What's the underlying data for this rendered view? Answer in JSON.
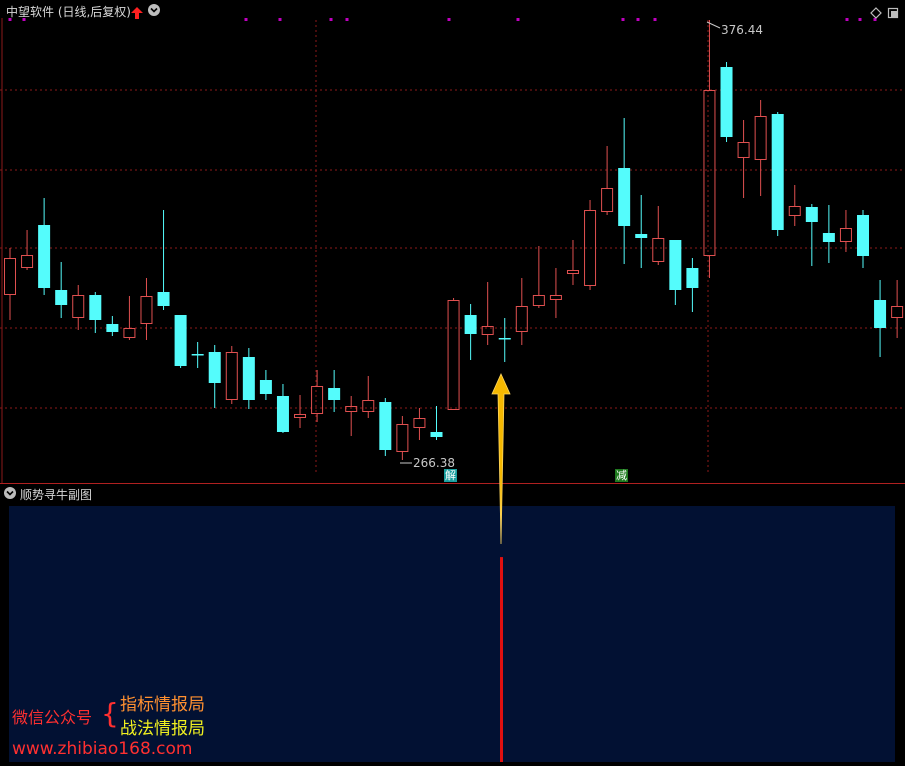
{
  "header": {
    "title": "中望软件 (日线,后复权)",
    "up_arrow": "arrow-up-icon",
    "collapse_icon": "chevron-down-icon",
    "right_icons": [
      "diamond-icon",
      "restore-icon"
    ]
  },
  "price_labels": {
    "high": "376.44",
    "low": "266.38"
  },
  "signals": {
    "jie": "解",
    "jian": "减"
  },
  "subchart": {
    "title": "顺势寻牛副图"
  },
  "watermark": {
    "account_label": "微信公众号",
    "line1": "指标情报局",
    "line2": "战法情报局",
    "url": "www.zhibiao168.com"
  },
  "colors": {
    "background": "#000000",
    "up": "#e05050",
    "down": "#54fcfc",
    "grid": "#8b1a1a",
    "panel": "#021133",
    "marker": "#c000c0",
    "arrow": "#f5b800",
    "bar": "#e01010"
  },
  "candles": [
    [
      295,
      258,
      248,
      320
    ],
    [
      268,
      255,
      230,
      270
    ],
    [
      225,
      288,
      198,
      295
    ],
    [
      290,
      305,
      262,
      318
    ],
    [
      318,
      295,
      285,
      330
    ],
    [
      295,
      320,
      292,
      333
    ],
    [
      324,
      332,
      316,
      336
    ],
    [
      338,
      328,
      296,
      340
    ],
    [
      324,
      296,
      278,
      340
    ],
    [
      292,
      306,
      210,
      310
    ],
    [
      315,
      366,
      315,
      368
    ],
    [
      354,
      354,
      342,
      368
    ],
    [
      352,
      383,
      345,
      408
    ],
    [
      400,
      352,
      346,
      404
    ],
    [
      357,
      400,
      348,
      409
    ],
    [
      380,
      394,
      370,
      400
    ],
    [
      396,
      432,
      384,
      433
    ],
    [
      418,
      414,
      395,
      428
    ],
    [
      414,
      386,
      370,
      422
    ],
    [
      388,
      400,
      370,
      412
    ],
    [
      412,
      406,
      396,
      436
    ],
    [
      412,
      400,
      376,
      418
    ],
    [
      402,
      450,
      398,
      456
    ],
    [
      452,
      424,
      416,
      460
    ],
    [
      428,
      418,
      408,
      440
    ],
    [
      432,
      437,
      406,
      440
    ],
    [
      410,
      300,
      298,
      410
    ],
    [
      315,
      334,
      304,
      360
    ],
    [
      335,
      326,
      282,
      345
    ],
    [
      338,
      338,
      318,
      362
    ],
    [
      332,
      306,
      278,
      345
    ],
    [
      306,
      295,
      246,
      308
    ],
    [
      300,
      295,
      268,
      318
    ],
    [
      274,
      270,
      240,
      285
    ],
    [
      286,
      210,
      200,
      290
    ],
    [
      212,
      188,
      146,
      215
    ],
    [
      168,
      226,
      118,
      264
    ],
    [
      234,
      238,
      195,
      268
    ],
    [
      262,
      238,
      206,
      265
    ],
    [
      240,
      290,
      240,
      305
    ],
    [
      268,
      288,
      258,
      312
    ],
    [
      256,
      90,
      20,
      278
    ],
    [
      67,
      137,
      62,
      142
    ],
    [
      158,
      142,
      120,
      198
    ],
    [
      160,
      116,
      100,
      196
    ],
    [
      114,
      230,
      112,
      236
    ],
    [
      216,
      206,
      185,
      226
    ],
    [
      207,
      222,
      204,
      266
    ],
    [
      233,
      242,
      205,
      263
    ],
    [
      242,
      228,
      210,
      252
    ],
    [
      215,
      256,
      210,
      268
    ],
    [
      300,
      328,
      280,
      357
    ],
    [
      318,
      306,
      280,
      338
    ]
  ],
  "volume_bar_fraction": 0.94
}
